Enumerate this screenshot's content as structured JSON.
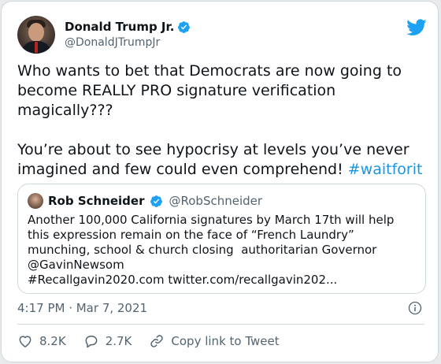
{
  "tweet": {
    "author": {
      "display_name": "Donald Trump Jr.",
      "handle": "@DonaldJTrumpJr",
      "verified": true
    },
    "text_lines": [
      "Who wants to bet that Democrats are now going to",
      "become REALLY PRO signature verification",
      "magically???",
      "",
      "You’re about to see hypocrisy at levels you’ve never",
      "imagined and few could even comprehend! "
    ],
    "hashtag": "#waitforit",
    "timestamp": "4:17 PM · Mar 7, 2021"
  },
  "quoted_tweet": {
    "display_name": "Rob Schneider",
    "handle": "@RobSchneider",
    "verified": true,
    "text_lines": [
      "Another 100,000 California signatures by March 17th will help",
      "this expression remain on the face of “French Laundry”",
      "munching, school & church closing  authoritarian Governor",
      "@GavinNewsom",
      "#Recallgavin2020.com twitter.com/recallgavin202..."
    ]
  },
  "actions": {
    "likes": "8.2K",
    "replies": "2.7K",
    "copy_link_label": "Copy link to Tweet"
  },
  "icons": {
    "brand": "twitter-bird-icon",
    "verified": "verified-badge-icon",
    "info": "info-icon",
    "like": "heart-icon",
    "reply": "reply-bubble-icon",
    "link": "link-icon"
  },
  "colors": {
    "brand_blue": "#1da1f2",
    "hashtag": "#1b95e0",
    "secondary_text": "#536471",
    "border": "#cfd9de"
  }
}
